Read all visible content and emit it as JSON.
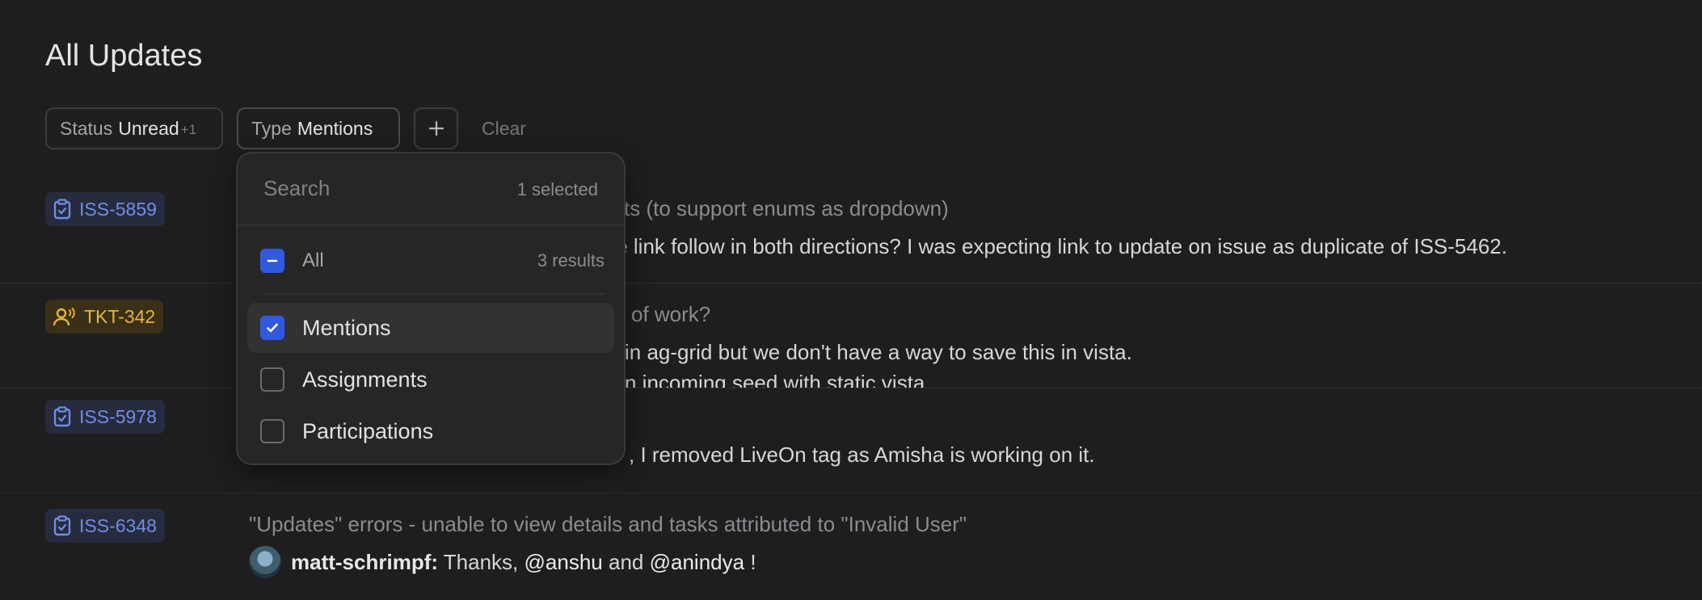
{
  "page": {
    "title": "All Updates"
  },
  "filters": {
    "status": {
      "label": "Status",
      "value": "Unread",
      "extra": "+1"
    },
    "type": {
      "label": "Type",
      "value": "Mentions"
    },
    "add_icon": "plus-icon",
    "clear_label": "Clear"
  },
  "rows": [
    {
      "key": "ISS-5859",
      "kind": "issue",
      "icon": "clipboard-icon",
      "title_visible": "r traits (to support enums as dropdown)",
      "comment_visible": "te link follow in both directions? I was expecting link to update on issue as duplicate of ISS-5462."
    },
    {
      "key": "TKT-342",
      "kind": "ticket",
      "icon": "person-speaking-icon",
      "title_visible": "w of work?",
      "comment_visible": "in ag-grid but we don't have a way to save this in vista.",
      "comment_visible_2": "n incoming seed with static vista"
    },
    {
      "key": "ISS-5978",
      "kind": "issue",
      "icon": "clipboard-icon",
      "comment_visible": ", I removed LiveOn tag as Amisha is working on it."
    },
    {
      "key": "ISS-6348",
      "kind": "issue",
      "icon": "clipboard-icon",
      "title": "\"Updates\" errors - unable to view details and tasks attributed to \"Invalid User\"",
      "author": "matt-schrimpf:",
      "comment_pre": "Thanks,",
      "mention_1": "@anshu",
      "and": "and",
      "mention_2": "@anindya",
      "comment_post": "!"
    }
  ],
  "dropdown": {
    "search_placeholder": "Search",
    "selected_count": "1 selected",
    "all_label": "All",
    "results_count": "3 results",
    "options": [
      {
        "label": "Mentions",
        "checked": true
      },
      {
        "label": "Assignments",
        "checked": false
      },
      {
        "label": "Participations",
        "checked": false
      }
    ]
  },
  "colors": {
    "background": "#1e1e1f",
    "issue_tag": "#6f8fe6",
    "ticket_tag": "#e7b43b",
    "checkbox_on": "#3159e0"
  }
}
